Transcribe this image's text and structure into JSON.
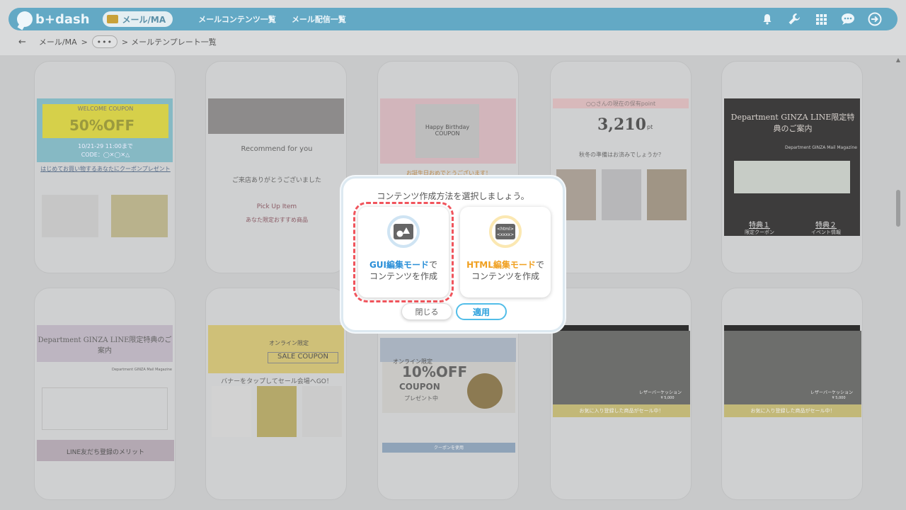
{
  "app": {
    "logo_text": "b+dash"
  },
  "nav": {
    "active_item": "メール/MA",
    "links": [
      "メールコンテンツ一覧",
      "メール配信一覧"
    ],
    "icons": [
      "bell-icon",
      "wrench-icon",
      "apps-grid-icon",
      "chat-icon",
      "logout-icon"
    ]
  },
  "breadcrumb": {
    "back": "←",
    "items": [
      "メール/MA",
      "•••",
      "メールテンプレート一覧"
    ],
    "separator": ">"
  },
  "templates": [
    {
      "title": "WELCOME COUPON",
      "headline": "50%OFF",
      "date": "10/21-29 11:00まで",
      "code": "CODE：◯✕◯✕△",
      "caption": "はじめてお買い物するあなたにクーポンプレゼント"
    },
    {
      "title": "Recommend for you",
      "caption": "ご来店ありがとうございました",
      "sub": "Pick Up Item",
      "sub2": "あなた限定おすすめ商品"
    },
    {
      "title": "Happy Birthday COUPON",
      "caption": "お誕生日おめでとうございます！"
    },
    {
      "title": "○○さんの現在の保有point",
      "headline": "3,210",
      "unit": "pt",
      "caption": "秋冬の準備はお済みでしょうか？"
    },
    {
      "title": "Department GINZA LINE限定特典のご案内",
      "sub": "Department GINZA Mail Magazine",
      "btn1": "特典１",
      "btn2": "特典２",
      "btn1_sub": "限定クーポン",
      "btn2_sub": "イベント情報"
    },
    {
      "title": "Department GINZA LINE限定特典のご案内",
      "sub": "Department GINZA Mail Magazine",
      "caption": "LINE友だち登録のメリット"
    },
    {
      "title": "オンライン限定",
      "headline": "SALE COUPON",
      "caption": "バナーをタップしてセール会場へGO！"
    },
    {
      "title": "オンライン限定",
      "headline": "10%OFF",
      "sub": "COUPON",
      "sub2": "プレゼント中",
      "btn1": "クーポンを使用"
    },
    {
      "title": "レザーバーケッション",
      "caption": "お気に入り登録した商品がセール中！",
      "price": "¥ 5,000"
    },
    {
      "title": "レザーバーケッション",
      "caption": "お気に入り登録した商品がセール中！",
      "price": "¥ 5,000"
    }
  ],
  "dialog": {
    "title": "コンテンツ作成方法を選択しましょう。",
    "options": [
      {
        "highlight": "GUI編集モード",
        "suffix": "で",
        "line2": "コンテンツを作成",
        "icon": "image-shapes-icon",
        "selected": true
      },
      {
        "highlight": "HTML編集モード",
        "suffix": "で",
        "line2": "コンテンツを作成",
        "icon": "html-code-icon",
        "selected": false
      }
    ],
    "close_label": "閉じる",
    "apply_label": "適用"
  },
  "colors": {
    "nav": "#63a9c5",
    "gui_accent": "#2a8fd8",
    "html_accent": "#f0a020",
    "selection_outline": "#f0545c",
    "apply": "#52bde8"
  }
}
